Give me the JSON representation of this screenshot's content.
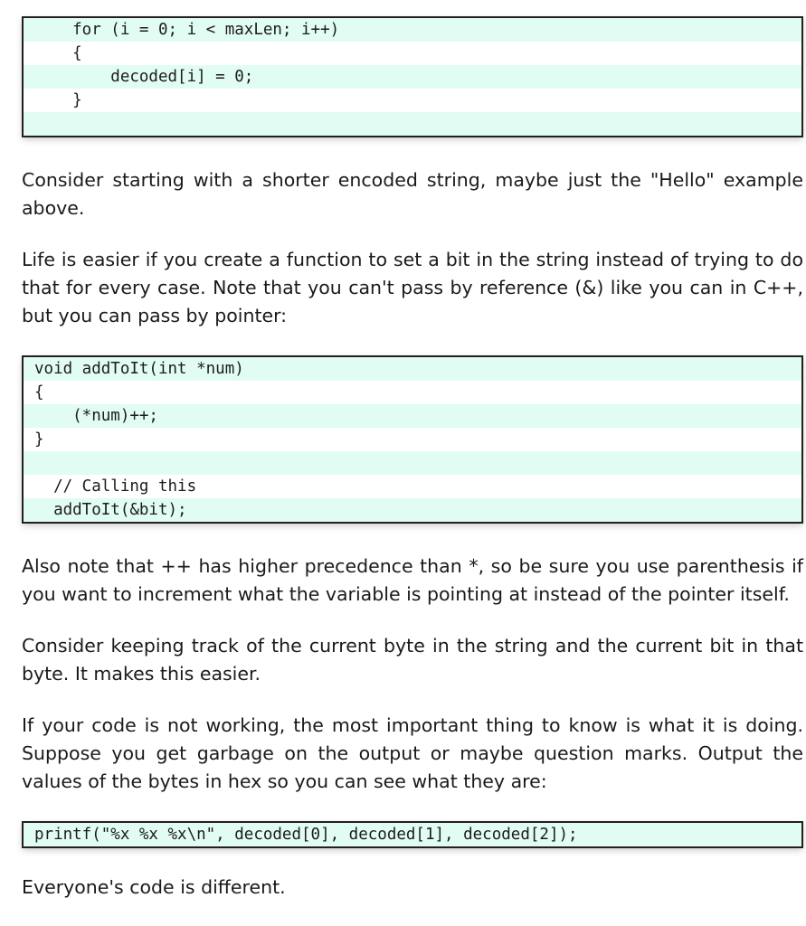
{
  "document": {
    "blocks": [
      {
        "kind": "code",
        "name": "code-block-for-loop",
        "lines": [
          "    for (i = 0; i < maxLen; i++)",
          "    {",
          "        decoded[i] = 0;",
          "    }",
          ""
        ]
      },
      {
        "kind": "paragraph",
        "name": "paragraph-consider-shorter-string",
        "text": "Consider starting with a shorter encoded string, maybe just the \"Hello\" example above."
      },
      {
        "kind": "paragraph",
        "name": "paragraph-life-is-easier",
        "text": "Life is easier if you create a function to set a bit in the string instead of trying to do that for every case. Note that you can't pass by reference (&) like you can in C++, but you can pass by pointer:"
      },
      {
        "kind": "code",
        "name": "code-block-add-to-it",
        "lines": [
          "void addToIt(int *num)",
          "{",
          "    (*num)++;",
          "}",
          "",
          "  // Calling this",
          "  addToIt(&bit);"
        ]
      },
      {
        "kind": "paragraph",
        "name": "paragraph-precedence-note",
        "text": "Also note that ++ has higher precedence than *, so be sure you use parenthesis if you want to increment what the variable is pointing at instead of the pointer itself."
      },
      {
        "kind": "paragraph",
        "name": "paragraph-keep-track-of-byte",
        "text": "Consider keeping track of the current byte in the string and the current bit in that byte. It makes this easier."
      },
      {
        "kind": "paragraph",
        "name": "paragraph-debug-output-hex",
        "text": "If your code is not working, the most important thing to know is what it is doing. Suppose you get garbage on the output or maybe question marks. Output the values of the bytes in hex so you can see what they are:"
      },
      {
        "kind": "code",
        "name": "code-block-printf-hex",
        "lines": [
          "printf(\"%x %x %x\\n\", decoded[0], decoded[1], decoded[2]);"
        ]
      },
      {
        "kind": "paragraph",
        "name": "paragraph-everyone-code-different",
        "text": "Everyone's code is different."
      }
    ]
  },
  "colors": {
    "code_stripe_mint": "#e1fdf3",
    "code_stripe_white": "#ffffff",
    "code_border": "#231f1c",
    "body_text": "#1a1a1a",
    "page_background": "#ffffff"
  }
}
